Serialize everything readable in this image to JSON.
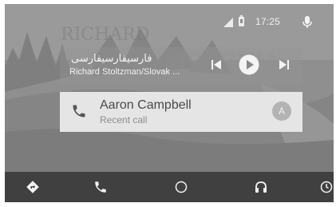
{
  "status_bar": {
    "time": "17:25",
    "icons": [
      "signal-icon",
      "battery-icon",
      "microphone-icon"
    ]
  },
  "media_card": {
    "track_title": "فارسیفارسیفارسی",
    "artist_album": "Richard Stoltzman/Slovak ...",
    "controls": [
      "skip-previous-icon",
      "play-icon",
      "skip-next-icon"
    ]
  },
  "recent_call_card": {
    "contact_name": "Aaron Campbell",
    "status": "Recent call",
    "avatar_initial": "A",
    "icon": "phone-icon"
  },
  "nav_bar": {
    "items": [
      {
        "icon": "navigation-icon"
      },
      {
        "icon": "phone-icon"
      },
      {
        "icon": "home-circle-icon"
      },
      {
        "icon": "headphones-icon"
      },
      {
        "icon": "overview-icon"
      }
    ]
  },
  "colors": {
    "background": "#8f8f8f",
    "card_media": "#9b9b9b",
    "card_call": "#e5e5e5",
    "nav_bar": "#404040",
    "icon_light": "#f4f4f4",
    "text_dark": "#4a4a4a"
  }
}
